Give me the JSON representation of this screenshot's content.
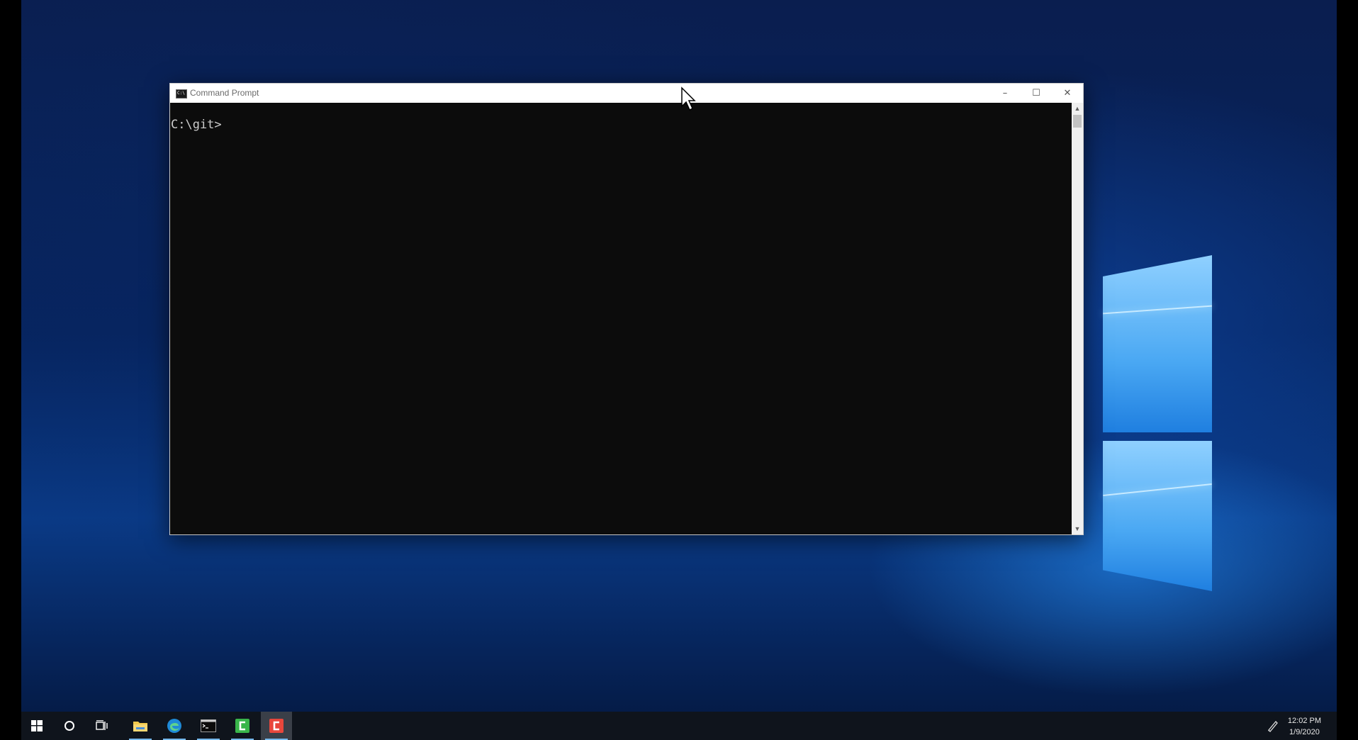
{
  "window": {
    "title": "Command Prompt",
    "icon_text": "C:\\",
    "controls": {
      "minimize": "–",
      "maximize": "☐",
      "close": "✕"
    }
  },
  "console": {
    "prompt": "C:\\git>"
  },
  "taskbar": {
    "items": [
      "start-icon",
      "search-icon",
      "task-view-icon",
      "file-explorer-icon",
      "edge-icon",
      "command-prompt-icon",
      "green-app-icon",
      "red-app-icon"
    ],
    "clock_time": "12:02 PM",
    "clock_date": "1/9/2020"
  },
  "colors": {
    "console_bg": "#0c0c0c",
    "console_text": "#cccccc",
    "taskbar_bg": "#0f141c",
    "accent": "#76b9ed"
  }
}
